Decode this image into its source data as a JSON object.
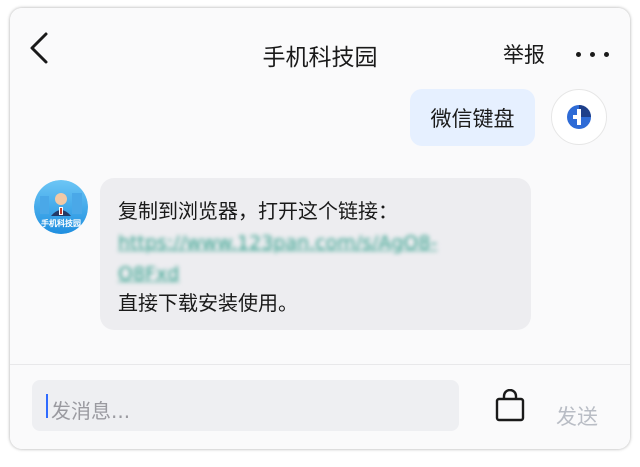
{
  "header": {
    "title": "手机科技园",
    "report_label": "举报"
  },
  "messages": {
    "outgoing_text": "微信键盘",
    "incoming": {
      "avatar_text": "手机科技园",
      "line1": "复制到浏览器，打开这个链接：",
      "link": "https://www.123pan.com/s/AgO8-O8Fxd",
      "line3": "直接下载安装使用。"
    }
  },
  "composer": {
    "placeholder": "发消息...",
    "send_label": "发送"
  },
  "colors": {
    "outgoing_bubble": "#e6f0ff",
    "incoming_bubble": "#ededf0",
    "link": "#2e9e8a",
    "caret": "#2f6bff",
    "send_disabled": "#b9bdc5"
  },
  "icons": {
    "back": "chevron-left-icon",
    "more": "more-icon",
    "bag": "shopping-bag-icon"
  }
}
